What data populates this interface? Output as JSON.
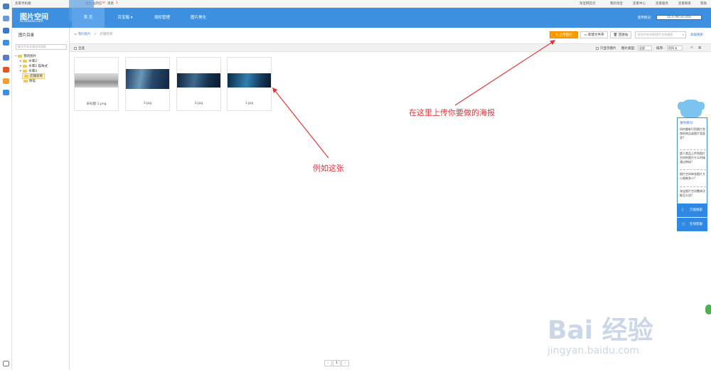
{
  "topbar": {
    "mobile": "卖家手机端",
    "logout": "退出",
    "messages_label": "站内信",
    "msg_tag": "消息",
    "msg_count": "1",
    "links": [
      "淘宝网首页",
      "我的淘宝",
      "卖家中心",
      "卖家服务",
      "卖家联系",
      "帮助"
    ]
  },
  "header": {
    "logo_main": "图片空间",
    "logo_sub": "tu.taobao.com",
    "nav": [
      "首 页",
      "百宝箱 ▾",
      "授权管理",
      "图片美化"
    ],
    "storage_label": "使用情况:",
    "storage_text": "10.67M/30.00G",
    "storage_used_ratio": 0.0004
  },
  "sidebar": {
    "title": "图片目录",
    "search_placeholder": "输文件夹名称回车搜索",
    "tree": [
      {
        "label": "我的图片",
        "level": 0,
        "expander": "−"
      },
      {
        "label": "水晕2",
        "level": 1,
        "expander": "+"
      },
      {
        "label": "水晕2 猫咪式",
        "level": 1,
        "expander": "+"
      },
      {
        "label": "水晕4",
        "level": 1,
        "expander": "+"
      },
      {
        "label": "店铺装修",
        "level": 1,
        "expander": "",
        "selected": true
      },
      {
        "label": "降笔",
        "level": 1,
        "expander": ""
      }
    ]
  },
  "main": {
    "breadcrumb_root": "我的图片",
    "breadcrumb_sep": ">",
    "breadcrumb_current": "店铺装修",
    "toolbar": {
      "upload": "上传图片",
      "new_folder": "新建文件夹",
      "recycle": "回收站",
      "search_placeholder": "按文件夹名称/图片名称搜索",
      "advanced": "高级搜索"
    },
    "filters": {
      "select_all": "全选",
      "only_show": "只显示图片",
      "type_label": "图片类型:",
      "type_value": "全部",
      "sort_label": "排序:",
      "sort_value": "时间 ⬇"
    },
    "images": [
      {
        "name": "未标题-1.png"
      },
      {
        "name": "3.jpg"
      },
      {
        "name": "2.jpg"
      },
      {
        "name": "1.jpg"
      }
    ],
    "pager": {
      "prev": "‹",
      "current": "1",
      "next": "›"
    }
  },
  "help": {
    "title": "猜你想问:",
    "questions": [
      "如何重新引用图片到商的商品或图片里面里?",
      "超人商品上传到图片空间的图片什么时候通过审核?",
      "图片空间单张图片大小限制多少?",
      "淘宝图片空间整体功能怎么用?"
    ],
    "btn1": "万能搜索",
    "btn2": "在线客服"
  },
  "annotations": {
    "upload_note": "在这里上传你要做的海报",
    "example_note": "例如这张"
  },
  "watermark": {
    "main": "Bai 经验",
    "sub": "jingyan.baidu.com"
  },
  "colors": {
    "header": "#3d8fe0",
    "upload_btn": "#ff9d00",
    "annotation": "#e6333a"
  }
}
